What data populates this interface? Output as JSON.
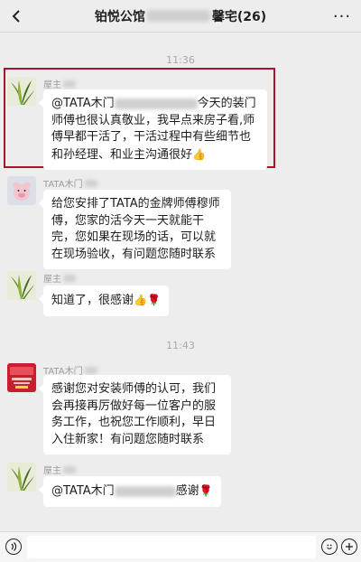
{
  "header": {
    "back_icon": "chevron-left-icon",
    "title_start": "铂悦公馆",
    "title_end": "馨宅(26)",
    "more_label": "···"
  },
  "messages": [
    {
      "time": "11:36"
    },
    {
      "sender": "屋主",
      "text_start": "@TATA木门",
      "text_mid": "今天的装门师傅也很认真敬业，我早点来房子看,师傅早都干活了，干活过程中有些细节也和孙经理、和业主沟通很好",
      "emoji": "👍"
    },
    {
      "sender": "TATA木门",
      "text": "给您安排了TATA的金牌师傅穆师傅，您家的活今天一天就能干完，您如果在现场的话，可以就在现场验收，有问题您随时联系"
    },
    {
      "sender": "屋主",
      "text": "知道了，很感谢",
      "emoji": "👍🌹"
    },
    {
      "time": "11:43"
    },
    {
      "sender": "TATA木门",
      "text": "感谢您对安装师傅的认可，我们会再接再厉做好每一位客户的服务工作，也祝您工作顺利，早日入住新家！有问题您随时联系"
    },
    {
      "sender": "屋主",
      "text_start": "@TATA木门",
      "text_end": "感谢",
      "emoji": "🌹"
    }
  ],
  "input_bar": {
    "voice_icon": "voice-icon",
    "emoji_icon": "emoji-icon",
    "plus_icon": "plus-icon"
  },
  "colors": {
    "background": "#ededed",
    "bubble": "#ffffff",
    "highlight": "#a8152a"
  }
}
